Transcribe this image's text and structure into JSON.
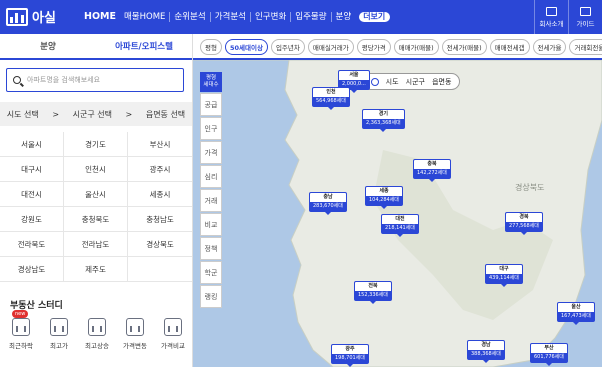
{
  "app": {
    "logo_text": "아실"
  },
  "nav": {
    "items": [
      "HOME",
      "매물HOME",
      "순위분석",
      "가격분석",
      "인구변화",
      "입주물량",
      "분양"
    ],
    "more": "더보기"
  },
  "right": {
    "items": [
      "회사소개",
      "가이드"
    ]
  },
  "sidebar": {
    "tabs": [
      "분양",
      "아파트/오피스텔"
    ],
    "search_placeholder": "아파트명을 검색해보세요",
    "crumbs": [
      "시도 선택",
      ">",
      "시군구 선택",
      ">",
      "읍면동 선택"
    ],
    "regions": [
      "서울시",
      "경기도",
      "부산시",
      "대구시",
      "인천시",
      "광주시",
      "대전시",
      "울산시",
      "세종시",
      "강원도",
      "충청북도",
      "충청남도",
      "전라북도",
      "전라남도",
      "경상북도",
      "경상남도",
      "제주도",
      ""
    ],
    "study_title": "부동산 스터디",
    "study_items": [
      {
        "label": "최근하락",
        "new": "new"
      },
      {
        "label": "최고가"
      },
      {
        "label": "최고상승"
      },
      {
        "label": "가격변동"
      },
      {
        "label": "가격비교"
      }
    ]
  },
  "filters": [
    "평형",
    "50세대이상",
    "입주년차",
    "매매실거래가",
    "평당가격",
    "매매가(매물)",
    "전세가(매물)",
    "매매전세갭",
    "전세가율",
    "거래회전율"
  ],
  "vtool": {
    "top": [
      "평형",
      "세대수"
    ],
    "items": [
      "공급",
      "인구",
      "가격",
      "심리",
      "거래",
      "비교",
      "정책",
      "학군",
      "랭킹"
    ]
  },
  "region_toggle": [
    "시도",
    "시군구",
    "읍면동"
  ],
  "markers": [
    {
      "name": "서울",
      "value": "2,000,0..."
    },
    {
      "name": "인천",
      "value": "564,968세대"
    },
    {
      "name": "경기",
      "value": "2,363,368세대"
    },
    {
      "name": "충북",
      "value": "142,272세대"
    },
    {
      "name": "충남",
      "value": "283,670세대"
    },
    {
      "name": "세종",
      "value": "104,284세대"
    },
    {
      "name": "대전",
      "value": "218,141세대"
    },
    {
      "name": "경북",
      "value": "277,568세대"
    },
    {
      "name": "대구",
      "value": "439,114세대"
    },
    {
      "name": "전북",
      "value": "152,336세대"
    },
    {
      "name": "울산",
      "value": "167,473세대"
    },
    {
      "name": "광주",
      "value": "198,701세대"
    },
    {
      "name": "경남",
      "value": "388,368세대"
    },
    {
      "name": "부산",
      "value": "601,776세대"
    }
  ],
  "map_labels": {
    "gyeongbuk": "경상북도"
  },
  "colors": {
    "primary": "#2b47d6",
    "land": "#e9ebe4",
    "sea": "#aec8e6"
  }
}
